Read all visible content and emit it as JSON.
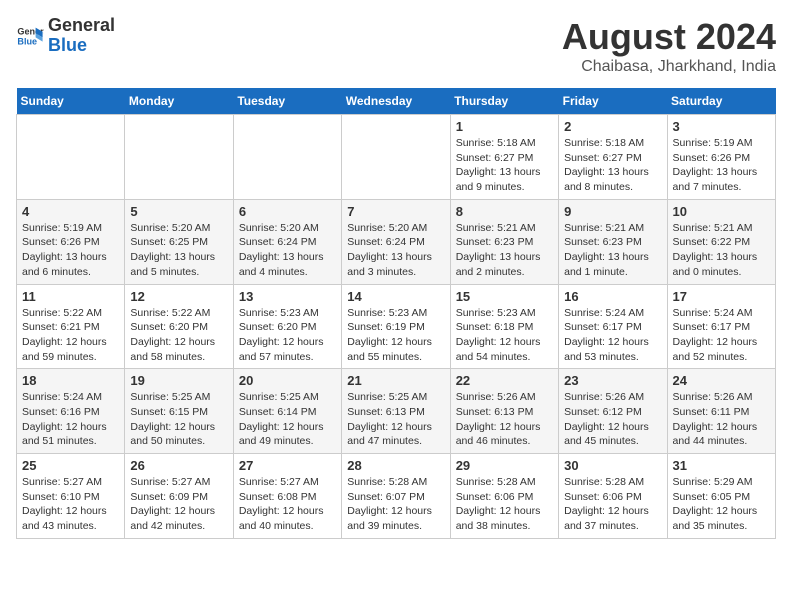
{
  "logo": {
    "line1": "General",
    "line2": "Blue"
  },
  "title": "August 2024",
  "subtitle": "Chaibasa, Jharkhand, India",
  "weekdays": [
    "Sunday",
    "Monday",
    "Tuesday",
    "Wednesday",
    "Thursday",
    "Friday",
    "Saturday"
  ],
  "weeks": [
    [
      {
        "day": "",
        "info": ""
      },
      {
        "day": "",
        "info": ""
      },
      {
        "day": "",
        "info": ""
      },
      {
        "day": "",
        "info": ""
      },
      {
        "day": "1",
        "info": "Sunrise: 5:18 AM\nSunset: 6:27 PM\nDaylight: 13 hours\nand 9 minutes."
      },
      {
        "day": "2",
        "info": "Sunrise: 5:18 AM\nSunset: 6:27 PM\nDaylight: 13 hours\nand 8 minutes."
      },
      {
        "day": "3",
        "info": "Sunrise: 5:19 AM\nSunset: 6:26 PM\nDaylight: 13 hours\nand 7 minutes."
      }
    ],
    [
      {
        "day": "4",
        "info": "Sunrise: 5:19 AM\nSunset: 6:26 PM\nDaylight: 13 hours\nand 6 minutes."
      },
      {
        "day": "5",
        "info": "Sunrise: 5:20 AM\nSunset: 6:25 PM\nDaylight: 13 hours\nand 5 minutes."
      },
      {
        "day": "6",
        "info": "Sunrise: 5:20 AM\nSunset: 6:24 PM\nDaylight: 13 hours\nand 4 minutes."
      },
      {
        "day": "7",
        "info": "Sunrise: 5:20 AM\nSunset: 6:24 PM\nDaylight: 13 hours\nand 3 minutes."
      },
      {
        "day": "8",
        "info": "Sunrise: 5:21 AM\nSunset: 6:23 PM\nDaylight: 13 hours\nand 2 minutes."
      },
      {
        "day": "9",
        "info": "Sunrise: 5:21 AM\nSunset: 6:23 PM\nDaylight: 13 hours\nand 1 minute."
      },
      {
        "day": "10",
        "info": "Sunrise: 5:21 AM\nSunset: 6:22 PM\nDaylight: 13 hours\nand 0 minutes."
      }
    ],
    [
      {
        "day": "11",
        "info": "Sunrise: 5:22 AM\nSunset: 6:21 PM\nDaylight: 12 hours\nand 59 minutes."
      },
      {
        "day": "12",
        "info": "Sunrise: 5:22 AM\nSunset: 6:20 PM\nDaylight: 12 hours\nand 58 minutes."
      },
      {
        "day": "13",
        "info": "Sunrise: 5:23 AM\nSunset: 6:20 PM\nDaylight: 12 hours\nand 57 minutes."
      },
      {
        "day": "14",
        "info": "Sunrise: 5:23 AM\nSunset: 6:19 PM\nDaylight: 12 hours\nand 55 minutes."
      },
      {
        "day": "15",
        "info": "Sunrise: 5:23 AM\nSunset: 6:18 PM\nDaylight: 12 hours\nand 54 minutes."
      },
      {
        "day": "16",
        "info": "Sunrise: 5:24 AM\nSunset: 6:17 PM\nDaylight: 12 hours\nand 53 minutes."
      },
      {
        "day": "17",
        "info": "Sunrise: 5:24 AM\nSunset: 6:17 PM\nDaylight: 12 hours\nand 52 minutes."
      }
    ],
    [
      {
        "day": "18",
        "info": "Sunrise: 5:24 AM\nSunset: 6:16 PM\nDaylight: 12 hours\nand 51 minutes."
      },
      {
        "day": "19",
        "info": "Sunrise: 5:25 AM\nSunset: 6:15 PM\nDaylight: 12 hours\nand 50 minutes."
      },
      {
        "day": "20",
        "info": "Sunrise: 5:25 AM\nSunset: 6:14 PM\nDaylight: 12 hours\nand 49 minutes."
      },
      {
        "day": "21",
        "info": "Sunrise: 5:25 AM\nSunset: 6:13 PM\nDaylight: 12 hours\nand 47 minutes."
      },
      {
        "day": "22",
        "info": "Sunrise: 5:26 AM\nSunset: 6:13 PM\nDaylight: 12 hours\nand 46 minutes."
      },
      {
        "day": "23",
        "info": "Sunrise: 5:26 AM\nSunset: 6:12 PM\nDaylight: 12 hours\nand 45 minutes."
      },
      {
        "day": "24",
        "info": "Sunrise: 5:26 AM\nSunset: 6:11 PM\nDaylight: 12 hours\nand 44 minutes."
      }
    ],
    [
      {
        "day": "25",
        "info": "Sunrise: 5:27 AM\nSunset: 6:10 PM\nDaylight: 12 hours\nand 43 minutes."
      },
      {
        "day": "26",
        "info": "Sunrise: 5:27 AM\nSunset: 6:09 PM\nDaylight: 12 hours\nand 42 minutes."
      },
      {
        "day": "27",
        "info": "Sunrise: 5:27 AM\nSunset: 6:08 PM\nDaylight: 12 hours\nand 40 minutes."
      },
      {
        "day": "28",
        "info": "Sunrise: 5:28 AM\nSunset: 6:07 PM\nDaylight: 12 hours\nand 39 minutes."
      },
      {
        "day": "29",
        "info": "Sunrise: 5:28 AM\nSunset: 6:06 PM\nDaylight: 12 hours\nand 38 minutes."
      },
      {
        "day": "30",
        "info": "Sunrise: 5:28 AM\nSunset: 6:06 PM\nDaylight: 12 hours\nand 37 minutes."
      },
      {
        "day": "31",
        "info": "Sunrise: 5:29 AM\nSunset: 6:05 PM\nDaylight: 12 hours\nand 35 minutes."
      }
    ]
  ]
}
